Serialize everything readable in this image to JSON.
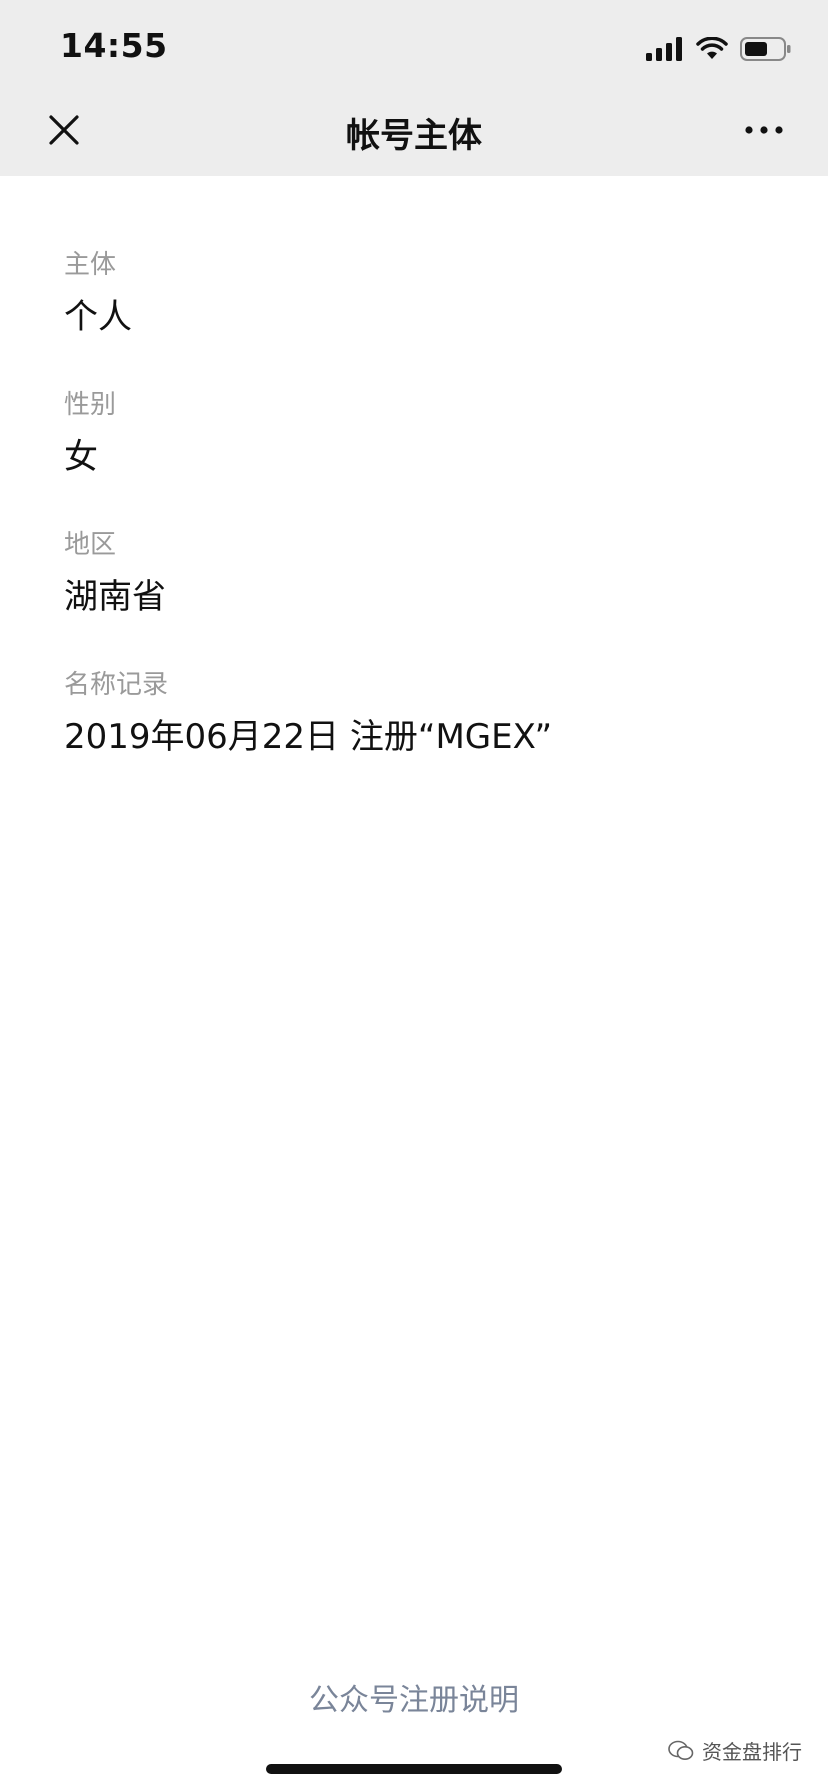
{
  "status_bar": {
    "time": "14:55"
  },
  "nav": {
    "title": "帐号主体",
    "close_icon": "close-icon",
    "more_icon": "more-icon"
  },
  "fields": [
    {
      "label": "主体",
      "value": "个人"
    },
    {
      "label": "性别",
      "value": "女"
    },
    {
      "label": "地区",
      "value": "湖南省"
    },
    {
      "label": "名称记录",
      "value": "2019年06月22日 注册“MGEX”"
    }
  ],
  "footer": {
    "link": "公众号注册说明"
  },
  "watermark": {
    "text": "资金盘排行"
  },
  "colors": {
    "header_bg": "#ededed",
    "label": "#9a9a9a",
    "value": "#111111",
    "link": "#7a8599"
  }
}
